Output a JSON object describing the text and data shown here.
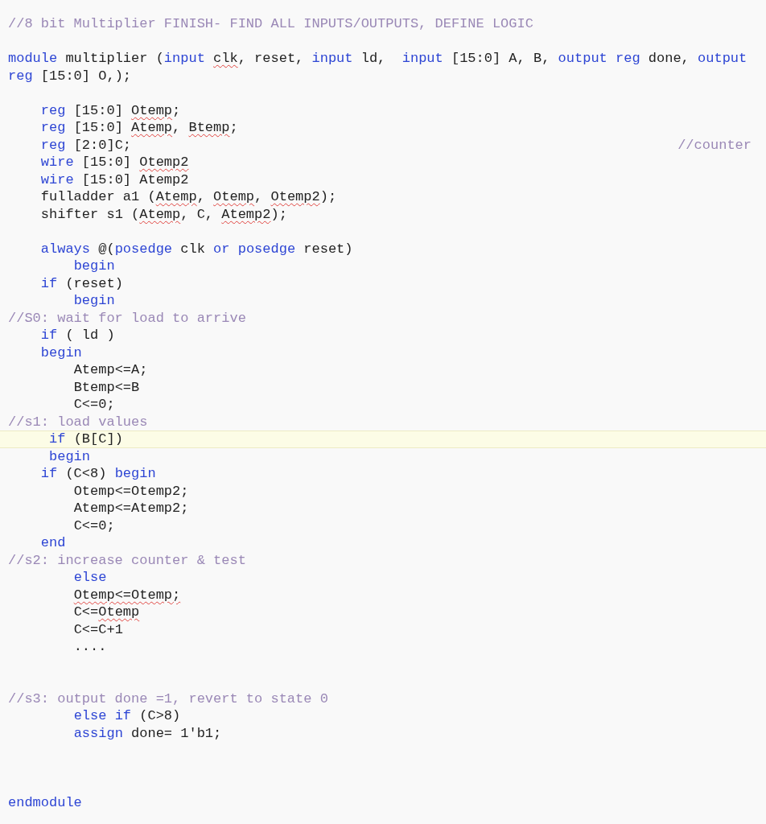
{
  "editor": {
    "lines": [
      {
        "highlighted": false,
        "tokens": [
          {
            "kind": "comment",
            "text": "//8 bit Multiplier FINISH- FIND ALL INPUTS/OUTPUTS, DEFINE LOGIC",
            "misspelled": false
          }
        ]
      },
      {
        "highlighted": false
      },
      {
        "highlighted": false,
        "tokens": [
          {
            "kind": "keyword",
            "text": "module",
            "misspelled": false
          },
          {
            "kind": "plain",
            "text": " multiplier (",
            "misspelled": false
          },
          {
            "kind": "keyword",
            "text": "input",
            "misspelled": false
          },
          {
            "kind": "plain",
            "text": " clk",
            "misspelled": true
          },
          {
            "kind": "plain",
            "text": ", reset, ",
            "misspelled": false
          },
          {
            "kind": "keyword",
            "text": "input",
            "misspelled": false
          },
          {
            "kind": "plain",
            "text": " ld,  ",
            "misspelled": false
          },
          {
            "kind": "keyword",
            "text": "input",
            "misspelled": false
          },
          {
            "kind": "plain",
            "text": " [15:0] A, B, ",
            "misspelled": false
          },
          {
            "kind": "keyword",
            "text": "output reg",
            "misspelled": false
          },
          {
            "kind": "plain",
            "text": " done, ",
            "misspelled": false
          },
          {
            "kind": "keyword",
            "text": "output",
            "misspelled": false
          }
        ]
      },
      {
        "highlighted": false,
        "tokens": [
          {
            "kind": "keyword",
            "text": "reg",
            "misspelled": false
          },
          {
            "kind": "plain",
            "text": " [15:0] O,);",
            "misspelled": false
          }
        ]
      },
      {
        "highlighted": false
      },
      {
        "highlighted": false,
        "tokens": [
          {
            "kind": "keyword",
            "text": "    reg",
            "misspelled": false
          },
          {
            "kind": "plain",
            "text": " [15:0] ",
            "misspelled": false
          },
          {
            "kind": "plain",
            "text": "Otemp",
            "misspelled": true
          },
          {
            "kind": "plain",
            "text": ";",
            "misspelled": false
          }
        ]
      },
      {
        "highlighted": false,
        "tokens": [
          {
            "kind": "keyword",
            "text": "    reg",
            "misspelled": false
          },
          {
            "kind": "plain",
            "text": " [15:0] ",
            "misspelled": false
          },
          {
            "kind": "plain",
            "text": "Atemp",
            "misspelled": true
          },
          {
            "kind": "plain",
            "text": ", ",
            "misspelled": false
          },
          {
            "kind": "plain",
            "text": "Btemp",
            "misspelled": true
          },
          {
            "kind": "plain",
            "text": ";",
            "misspelled": false
          }
        ]
      },
      {
        "highlighted": false,
        "tokens": [
          {
            "kind": "keyword",
            "text": "    reg",
            "misspelled": false
          },
          {
            "kind": "plain",
            "text": " [2:0]C;",
            "misspelled": false
          }
        ],
        "trailing_comment": "//counter"
      },
      {
        "highlighted": false,
        "tokens": [
          {
            "kind": "keyword",
            "text": "    wire",
            "misspelled": false
          },
          {
            "kind": "plain",
            "text": " [15:0] ",
            "misspelled": false
          },
          {
            "kind": "plain",
            "text": "Otemp2",
            "misspelled": true
          }
        ]
      },
      {
        "highlighted": false,
        "tokens": [
          {
            "kind": "keyword",
            "text": "    wire",
            "misspelled": false
          },
          {
            "kind": "plain",
            "text": " [15:0] Atemp2",
            "misspelled": false
          }
        ]
      },
      {
        "highlighted": false,
        "tokens": [
          {
            "kind": "plain",
            "text": "    fulladder a1 (",
            "misspelled": false
          },
          {
            "kind": "plain",
            "text": "Atemp",
            "misspelled": true
          },
          {
            "kind": "plain",
            "text": ", ",
            "misspelled": false
          },
          {
            "kind": "plain",
            "text": "Otemp",
            "misspelled": true
          },
          {
            "kind": "plain",
            "text": ", ",
            "misspelled": false
          },
          {
            "kind": "plain",
            "text": "Otemp2",
            "misspelled": true
          },
          {
            "kind": "plain",
            "text": ");",
            "misspelled": false
          }
        ]
      },
      {
        "highlighted": false,
        "tokens": [
          {
            "kind": "plain",
            "text": "    shifter s1 (",
            "misspelled": false
          },
          {
            "kind": "plain",
            "text": "Atemp",
            "misspelled": true
          },
          {
            "kind": "plain",
            "text": ", C, ",
            "misspelled": false
          },
          {
            "kind": "plain",
            "text": "Atemp2",
            "misspelled": true
          },
          {
            "kind": "plain",
            "text": ");",
            "misspelled": false
          }
        ]
      },
      {
        "highlighted": false
      },
      {
        "highlighted": false,
        "tokens": [
          {
            "kind": "keyword",
            "text": "    always",
            "misspelled": false
          },
          {
            "kind": "plain",
            "text": " @(",
            "misspelled": false
          },
          {
            "kind": "keyword",
            "text": "posedge",
            "misspelled": false
          },
          {
            "kind": "plain",
            "text": " clk ",
            "misspelled": false
          },
          {
            "kind": "keyword",
            "text": "or posedge",
            "misspelled": false
          },
          {
            "kind": "plain",
            "text": " reset)",
            "misspelled": false
          }
        ]
      },
      {
        "highlighted": false,
        "tokens": [
          {
            "kind": "keyword",
            "text": "        begin",
            "misspelled": false
          }
        ]
      },
      {
        "highlighted": false,
        "tokens": [
          {
            "kind": "keyword",
            "text": "    if",
            "misspelled": false
          },
          {
            "kind": "plain",
            "text": " (reset)",
            "misspelled": false
          }
        ]
      },
      {
        "highlighted": false,
        "tokens": [
          {
            "kind": "keyword",
            "text": "        begin",
            "misspelled": false
          }
        ]
      },
      {
        "highlighted": false,
        "tokens": [
          {
            "kind": "comment",
            "text": "//S0: wait for load to arrive",
            "misspelled": false
          }
        ]
      },
      {
        "highlighted": false,
        "tokens": [
          {
            "kind": "keyword",
            "text": "    if",
            "misspelled": false
          },
          {
            "kind": "plain",
            "text": " ( ld )",
            "misspelled": false
          }
        ]
      },
      {
        "highlighted": false,
        "tokens": [
          {
            "kind": "keyword",
            "text": "    begin",
            "misspelled": false
          }
        ]
      },
      {
        "highlighted": false,
        "tokens": [
          {
            "kind": "plain",
            "text": "        Atemp<=A;",
            "misspelled": false
          }
        ]
      },
      {
        "highlighted": false,
        "tokens": [
          {
            "kind": "plain",
            "text": "        Btemp<=B",
            "misspelled": false
          }
        ]
      },
      {
        "highlighted": false,
        "tokens": [
          {
            "kind": "plain",
            "text": "        C<=0;",
            "misspelled": false
          }
        ]
      },
      {
        "highlighted": false,
        "tokens": [
          {
            "kind": "comment",
            "text": "//s1: load values",
            "misspelled": false
          }
        ]
      },
      {
        "highlighted": true,
        "tokens": [
          {
            "kind": "keyword",
            "text": "     if",
            "misspelled": false
          },
          {
            "kind": "plain",
            "text": " (B[C])",
            "misspelled": false
          }
        ]
      },
      {
        "highlighted": false,
        "tokens": [
          {
            "kind": "keyword",
            "text": "     begin",
            "misspelled": false
          }
        ]
      },
      {
        "highlighted": false,
        "tokens": [
          {
            "kind": "keyword",
            "text": "    if",
            "misspelled": false
          },
          {
            "kind": "plain",
            "text": " (C<8) ",
            "misspelled": false
          },
          {
            "kind": "keyword",
            "text": "begin",
            "misspelled": false
          }
        ]
      },
      {
        "highlighted": false,
        "tokens": [
          {
            "kind": "plain",
            "text": "        Otemp<=Otemp2;",
            "misspelled": false
          }
        ]
      },
      {
        "highlighted": false,
        "tokens": [
          {
            "kind": "plain",
            "text": "        Atemp<=Atemp2;",
            "misspelled": false
          }
        ]
      },
      {
        "highlighted": false,
        "tokens": [
          {
            "kind": "plain",
            "text": "        C<=0;",
            "misspelled": false
          }
        ]
      },
      {
        "highlighted": false,
        "tokens": [
          {
            "kind": "keyword",
            "text": "    end",
            "misspelled": false
          }
        ]
      },
      {
        "highlighted": false,
        "tokens": [
          {
            "kind": "comment",
            "text": "//s2: increase counter & test",
            "misspelled": false
          }
        ]
      },
      {
        "highlighted": false,
        "tokens": [
          {
            "kind": "keyword",
            "text": "        else",
            "misspelled": false
          }
        ]
      },
      {
        "highlighted": false,
        "tokens": [
          {
            "kind": "plain",
            "text": "        Otemp<=Otemp;",
            "misspelled": true
          }
        ]
      },
      {
        "highlighted": false,
        "tokens": [
          {
            "kind": "plain",
            "text": "        C<=",
            "misspelled": false
          },
          {
            "kind": "plain",
            "text": "Otemp",
            "misspelled": true
          }
        ]
      },
      {
        "highlighted": false,
        "tokens": [
          {
            "kind": "plain",
            "text": "        C<=C+1",
            "misspelled": false
          }
        ]
      },
      {
        "highlighted": false,
        "tokens": [
          {
            "kind": "plain",
            "text": "        ....",
            "misspelled": false
          }
        ]
      },
      {
        "highlighted": false
      },
      {
        "highlighted": false
      },
      {
        "highlighted": false,
        "tokens": [
          {
            "kind": "comment",
            "text": "//s3: output done =1, revert to state 0",
            "misspelled": false
          }
        ]
      },
      {
        "highlighted": false,
        "tokens": [
          {
            "kind": "keyword",
            "text": "        else if",
            "misspelled": false
          },
          {
            "kind": "plain",
            "text": " (C>8)",
            "misspelled": false
          }
        ]
      },
      {
        "highlighted": false,
        "tokens": [
          {
            "kind": "keyword",
            "text": "        assign",
            "misspelled": false
          },
          {
            "kind": "plain",
            "text": " done= 1'b1;",
            "misspelled": false
          }
        ]
      },
      {
        "highlighted": false
      },
      {
        "highlighted": false
      },
      {
        "highlighted": false
      },
      {
        "highlighted": false,
        "tokens": [
          {
            "kind": "keyword",
            "text": "endmodule",
            "misspelled": false
          }
        ]
      }
    ]
  }
}
